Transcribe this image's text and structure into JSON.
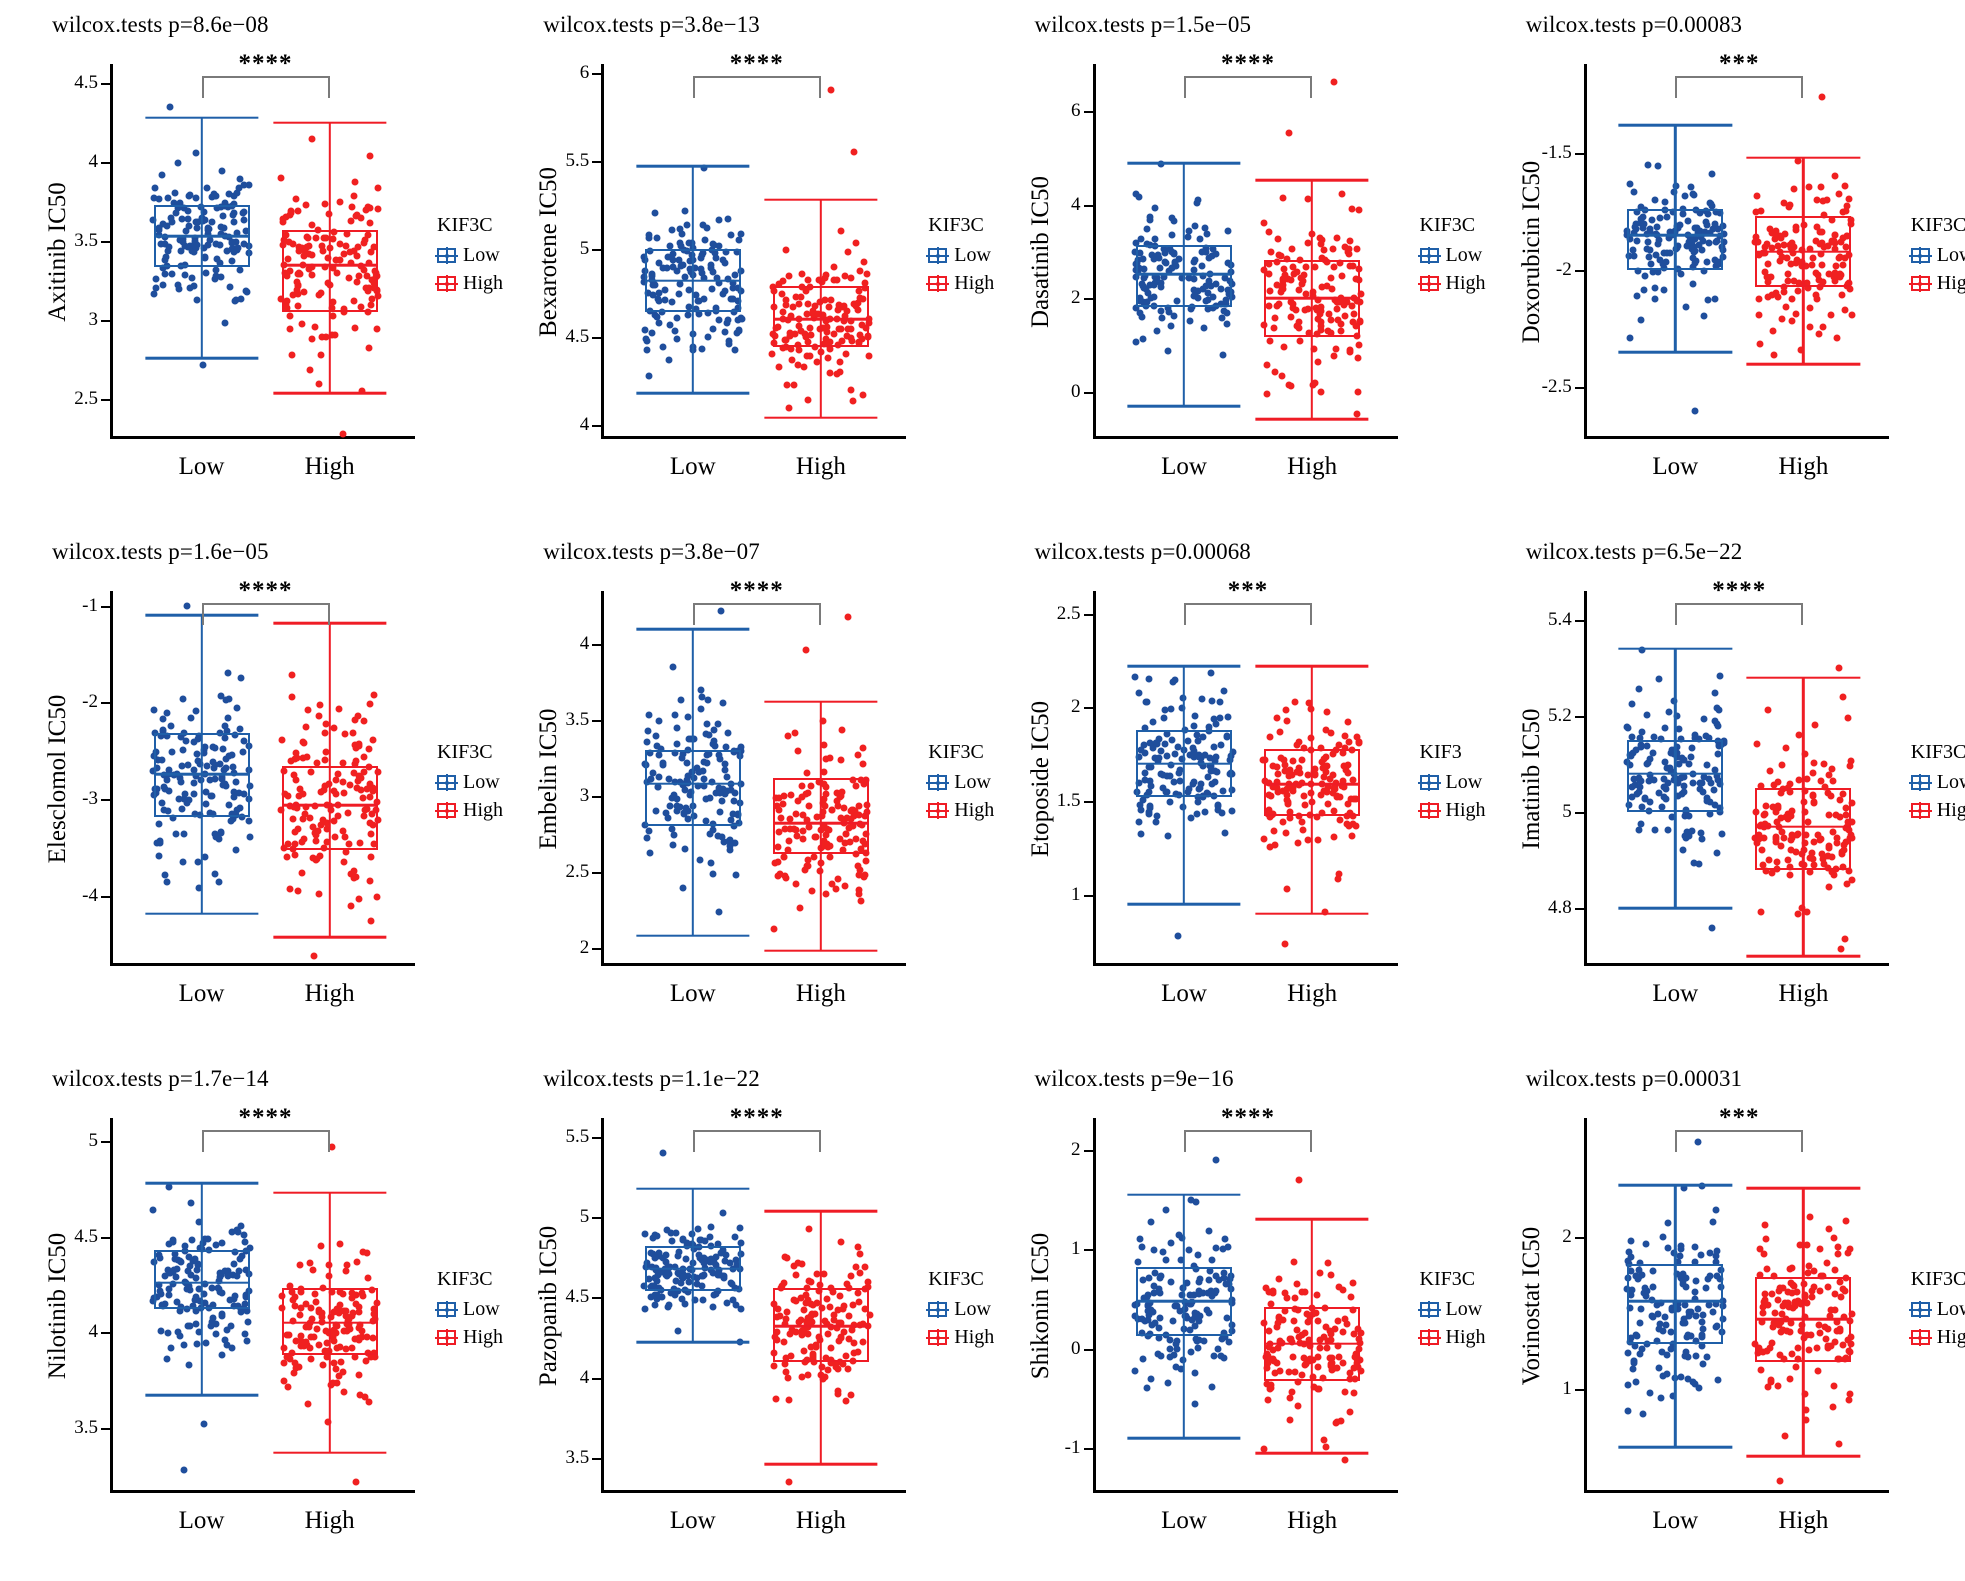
{
  "figure": {
    "group_labels": [
      "Low",
      "High"
    ],
    "colors": {
      "low": "#1f5fa8",
      "high": "#ef1c25",
      "low_dot": "#1f4e9c",
      "high_dot": "#f02020",
      "sigbar": "#7a7a7a"
    },
    "legend_defaults": {
      "title": "KIF3C",
      "items": [
        "Low",
        "High"
      ]
    }
  },
  "chart_data": [
    {
      "type": "box",
      "index": 0,
      "title": "wilcox.tests p=8.6e−08",
      "ylabel": "Axitinib IC50",
      "xlabel": "",
      "significance": "****",
      "legend": {
        "title": "KIF3C",
        "items": [
          "Low",
          "High"
        ]
      },
      "categories": [
        "Low",
        "High"
      ],
      "yticks": [
        2.5,
        3.0,
        3.5,
        4.0,
        4.5
      ],
      "ylim": [
        2.25,
        4.62
      ],
      "series": [
        {
          "name": "Low",
          "median": 3.53,
          "q1": 3.34,
          "q3": 3.73,
          "whisker_low": 2.76,
          "whisker_high": 4.28,
          "outliers": [
            4.35,
            2.72
          ]
        },
        {
          "name": "High",
          "median": 3.35,
          "q1": 3.05,
          "q3": 3.57,
          "whisker_low": 2.54,
          "whisker_high": 4.25,
          "outliers": [
            2.28
          ]
        }
      ]
    },
    {
      "type": "box",
      "index": 1,
      "title": "wilcox.tests p=3.8e−13",
      "ylabel": "Bexarotene IC50",
      "xlabel": "",
      "significance": "****",
      "legend": {
        "title": "KIF3C",
        "items": [
          "Low",
          "High"
        ]
      },
      "categories": [
        "Low",
        "High"
      ],
      "yticks": [
        4.0,
        4.5,
        5.0,
        5.5,
        6.0
      ],
      "ylim": [
        3.92,
        6.05
      ],
      "series": [
        {
          "name": "Low",
          "median": 4.82,
          "q1": 4.64,
          "q3": 5.0,
          "whisker_low": 4.18,
          "whisker_high": 5.47,
          "outliers": [
            5.46
          ]
        },
        {
          "name": "High",
          "median": 4.6,
          "q1": 4.44,
          "q3": 4.79,
          "whisker_low": 4.04,
          "whisker_high": 5.28,
          "outliers": [
            5.9,
            5.55
          ]
        }
      ]
    },
    {
      "type": "box",
      "index": 2,
      "title": "wilcox.tests p=1.5e−05",
      "ylabel": "Dasatinib IC50",
      "xlabel": "",
      "significance": "****",
      "legend": {
        "title": "KIF3C",
        "items": [
          "Low",
          "High"
        ]
      },
      "categories": [
        "Low",
        "High"
      ],
      "yticks": [
        0,
        2,
        4,
        6
      ],
      "ylim": [
        -1.0,
        7.0
      ],
      "series": [
        {
          "name": "Low",
          "median": 2.52,
          "q1": 1.82,
          "q3": 3.14,
          "whisker_low": -0.3,
          "whisker_high": 4.88,
          "outliers": [
            4.86
          ]
        },
        {
          "name": "High",
          "median": 2.0,
          "q1": 1.18,
          "q3": 2.82,
          "whisker_low": -0.58,
          "whisker_high": 4.52,
          "outliers": [
            6.62,
            5.52
          ]
        }
      ]
    },
    {
      "type": "box",
      "index": 3,
      "title": "wilcox.tests p=0.00083",
      "ylabel": "Doxorubicin IC50",
      "xlabel": "",
      "significance": "***",
      "legend": {
        "title": "KIF3C",
        "items": [
          "Low",
          "High"
        ]
      },
      "categories": [
        "Low",
        "High"
      ],
      "yticks": [
        -2.5,
        -2.0,
        -1.5
      ],
      "ylim": [
        -2.72,
        -1.12
      ],
      "series": [
        {
          "name": "Low",
          "median": -1.85,
          "q1": -2.0,
          "q3": -1.74,
          "whisker_low": -2.35,
          "whisker_high": -1.38,
          "outliers": [
            -2.6
          ]
        },
        {
          "name": "High",
          "median": -1.92,
          "q1": -2.07,
          "q3": -1.77,
          "whisker_low": -2.4,
          "whisker_high": -1.52,
          "outliers": [
            -1.26
          ]
        }
      ]
    },
    {
      "type": "box",
      "index": 4,
      "title": "wilcox.tests p=1.6e−05",
      "ylabel": "Elesclomol IC50",
      "xlabel": "",
      "significance": "****",
      "legend": {
        "title": "KIF3C",
        "items": [
          "Low",
          "High"
        ]
      },
      "categories": [
        "Low",
        "High"
      ],
      "yticks": [
        -4,
        -3,
        -2,
        -1
      ],
      "ylim": [
        -4.72,
        -0.85
      ],
      "series": [
        {
          "name": "Low",
          "median": -2.74,
          "q1": -3.18,
          "q3": -2.32,
          "whisker_low": -4.18,
          "whisker_high": -1.1,
          "outliers": [
            -1.0
          ]
        },
        {
          "name": "High",
          "median": -3.06,
          "q1": -3.52,
          "q3": -2.66,
          "whisker_low": -4.42,
          "whisker_high": -1.18,
          "outliers": [
            -4.62
          ]
        }
      ]
    },
    {
      "type": "box",
      "index": 5,
      "title": "wilcox.tests p=3.8e−07",
      "ylabel": "Embelin IC50",
      "xlabel": "",
      "significance": "****",
      "legend": {
        "title": "KIF3C",
        "items": [
          "Low",
          "High"
        ]
      },
      "categories": [
        "Low",
        "High"
      ],
      "yticks": [
        2.0,
        2.5,
        3.0,
        3.5,
        4.0
      ],
      "ylim": [
        1.88,
        4.35
      ],
      "series": [
        {
          "name": "Low",
          "median": 3.08,
          "q1": 2.8,
          "q3": 3.3,
          "whisker_low": 2.08,
          "whisker_high": 4.1,
          "outliers": [
            4.22
          ]
        },
        {
          "name": "High",
          "median": 2.82,
          "q1": 2.62,
          "q3": 3.12,
          "whisker_low": 1.98,
          "whisker_high": 3.62,
          "outliers": [
            4.18,
            3.96
          ]
        }
      ]
    },
    {
      "type": "box",
      "index": 6,
      "title": "wilcox.tests p=0.00068",
      "ylabel": "Etoposide IC50",
      "xlabel": "",
      "significance": "***",
      "legend": {
        "title": "KIF3",
        "items": [
          "Low",
          "High"
        ]
      },
      "categories": [
        "Low",
        "High"
      ],
      "yticks": [
        1.0,
        1.5,
        2.0,
        2.5
      ],
      "ylim": [
        0.62,
        2.62
      ],
      "series": [
        {
          "name": "Low",
          "median": 1.7,
          "q1": 1.52,
          "q3": 1.88,
          "whisker_low": 0.95,
          "whisker_high": 2.22,
          "outliers": [
            0.78
          ]
        },
        {
          "name": "High",
          "median": 1.59,
          "q1": 1.42,
          "q3": 1.78,
          "whisker_low": 0.9,
          "whisker_high": 2.22,
          "outliers": [
            0.74
          ]
        }
      ]
    },
    {
      "type": "box",
      "index": 7,
      "title": "wilcox.tests p=6.5e−22",
      "ylabel": "Imatinib IC50",
      "xlabel": "",
      "significance": "****",
      "legend": {
        "title": "KIF3C",
        "items": [
          "Low",
          "High"
        ]
      },
      "categories": [
        "Low",
        "High"
      ],
      "yticks": [
        4.8,
        5.0,
        5.2,
        5.4
      ],
      "ylim": [
        4.68,
        5.46
      ],
      "series": [
        {
          "name": "Low",
          "median": 5.08,
          "q1": 5.0,
          "q3": 5.15,
          "whisker_low": 4.8,
          "whisker_high": 5.34,
          "outliers": [
            4.76
          ]
        },
        {
          "name": "High",
          "median": 4.97,
          "q1": 4.88,
          "q3": 5.05,
          "whisker_low": 4.7,
          "whisker_high": 5.28,
          "outliers": [
            5.3
          ]
        }
      ]
    },
    {
      "type": "box",
      "index": 8,
      "title": "wilcox.tests p=1.7e−14",
      "ylabel": "Nilotinib IC50",
      "xlabel": "",
      "significance": "****",
      "legend": {
        "title": "KIF3C",
        "items": [
          "Low",
          "High"
        ]
      },
      "categories": [
        "Low",
        "High"
      ],
      "yticks": [
        3.5,
        4.0,
        4.5,
        5.0
      ],
      "ylim": [
        3.16,
        5.12
      ],
      "series": [
        {
          "name": "Low",
          "median": 4.26,
          "q1": 4.12,
          "q3": 4.43,
          "whisker_low": 3.67,
          "whisker_high": 4.78,
          "outliers": [
            3.52,
            3.28
          ]
        },
        {
          "name": "High",
          "median": 4.05,
          "q1": 3.88,
          "q3": 4.23,
          "whisker_low": 3.37,
          "whisker_high": 4.73,
          "outliers": [
            4.97,
            3.22
          ]
        }
      ]
    },
    {
      "type": "box",
      "index": 9,
      "title": "wilcox.tests p=1.1e−22",
      "ylabel": "Pazopanib IC50",
      "xlabel": "",
      "significance": "****",
      "legend": {
        "title": "KIF3C",
        "items": [
          "Low",
          "High"
        ]
      },
      "categories": [
        "Low",
        "High"
      ],
      "yticks": [
        3.5,
        4.0,
        4.5,
        5.0,
        5.5
      ],
      "ylim": [
        3.28,
        5.62
      ],
      "series": [
        {
          "name": "Low",
          "median": 4.68,
          "q1": 4.54,
          "q3": 4.82,
          "whisker_low": 4.22,
          "whisker_high": 5.18,
          "outliers": [
            5.4
          ]
        },
        {
          "name": "High",
          "median": 4.32,
          "q1": 4.1,
          "q3": 4.56,
          "whisker_low": 3.46,
          "whisker_high": 5.04,
          "outliers": [
            3.35
          ]
        }
      ]
    },
    {
      "type": "box",
      "index": 10,
      "title": "wilcox.tests p=9e−16",
      "ylabel": "Shikonin IC50",
      "xlabel": "",
      "significance": "****",
      "legend": {
        "title": "KIF3C",
        "items": [
          "Low",
          "High"
        ]
      },
      "categories": [
        "Low",
        "High"
      ],
      "yticks": [
        -1,
        0,
        1,
        2
      ],
      "ylim": [
        -1.45,
        2.32
      ],
      "series": [
        {
          "name": "Low",
          "median": 0.48,
          "q1": 0.13,
          "q3": 0.82,
          "whisker_low": -0.9,
          "whisker_high": 1.55,
          "outliers": [
            1.9
          ]
        },
        {
          "name": "High",
          "median": 0.05,
          "q1": -0.32,
          "q3": 0.42,
          "whisker_low": -1.05,
          "whisker_high": 1.3,
          "outliers": [
            1.7,
            -1.12
          ]
        }
      ]
    },
    {
      "type": "box",
      "index": 11,
      "title": "wilcox.tests p=0.00031",
      "ylabel": "Vorinostat IC50",
      "xlabel": "",
      "significance": "***",
      "legend": {
        "title": "KIF3C",
        "items": [
          "Low",
          "High"
        ]
      },
      "categories": [
        "Low",
        "High"
      ],
      "yticks": [
        1,
        2
      ],
      "ylim": [
        0.32,
        2.78
      ],
      "series": [
        {
          "name": "Low",
          "median": 1.58,
          "q1": 1.3,
          "q3": 1.82,
          "whisker_low": 0.62,
          "whisker_high": 2.34,
          "outliers": [
            2.62
          ]
        },
        {
          "name": "High",
          "median": 1.46,
          "q1": 1.18,
          "q3": 1.74,
          "whisker_low": 0.56,
          "whisker_high": 2.32,
          "outliers": [
            0.4
          ]
        }
      ]
    }
  ]
}
